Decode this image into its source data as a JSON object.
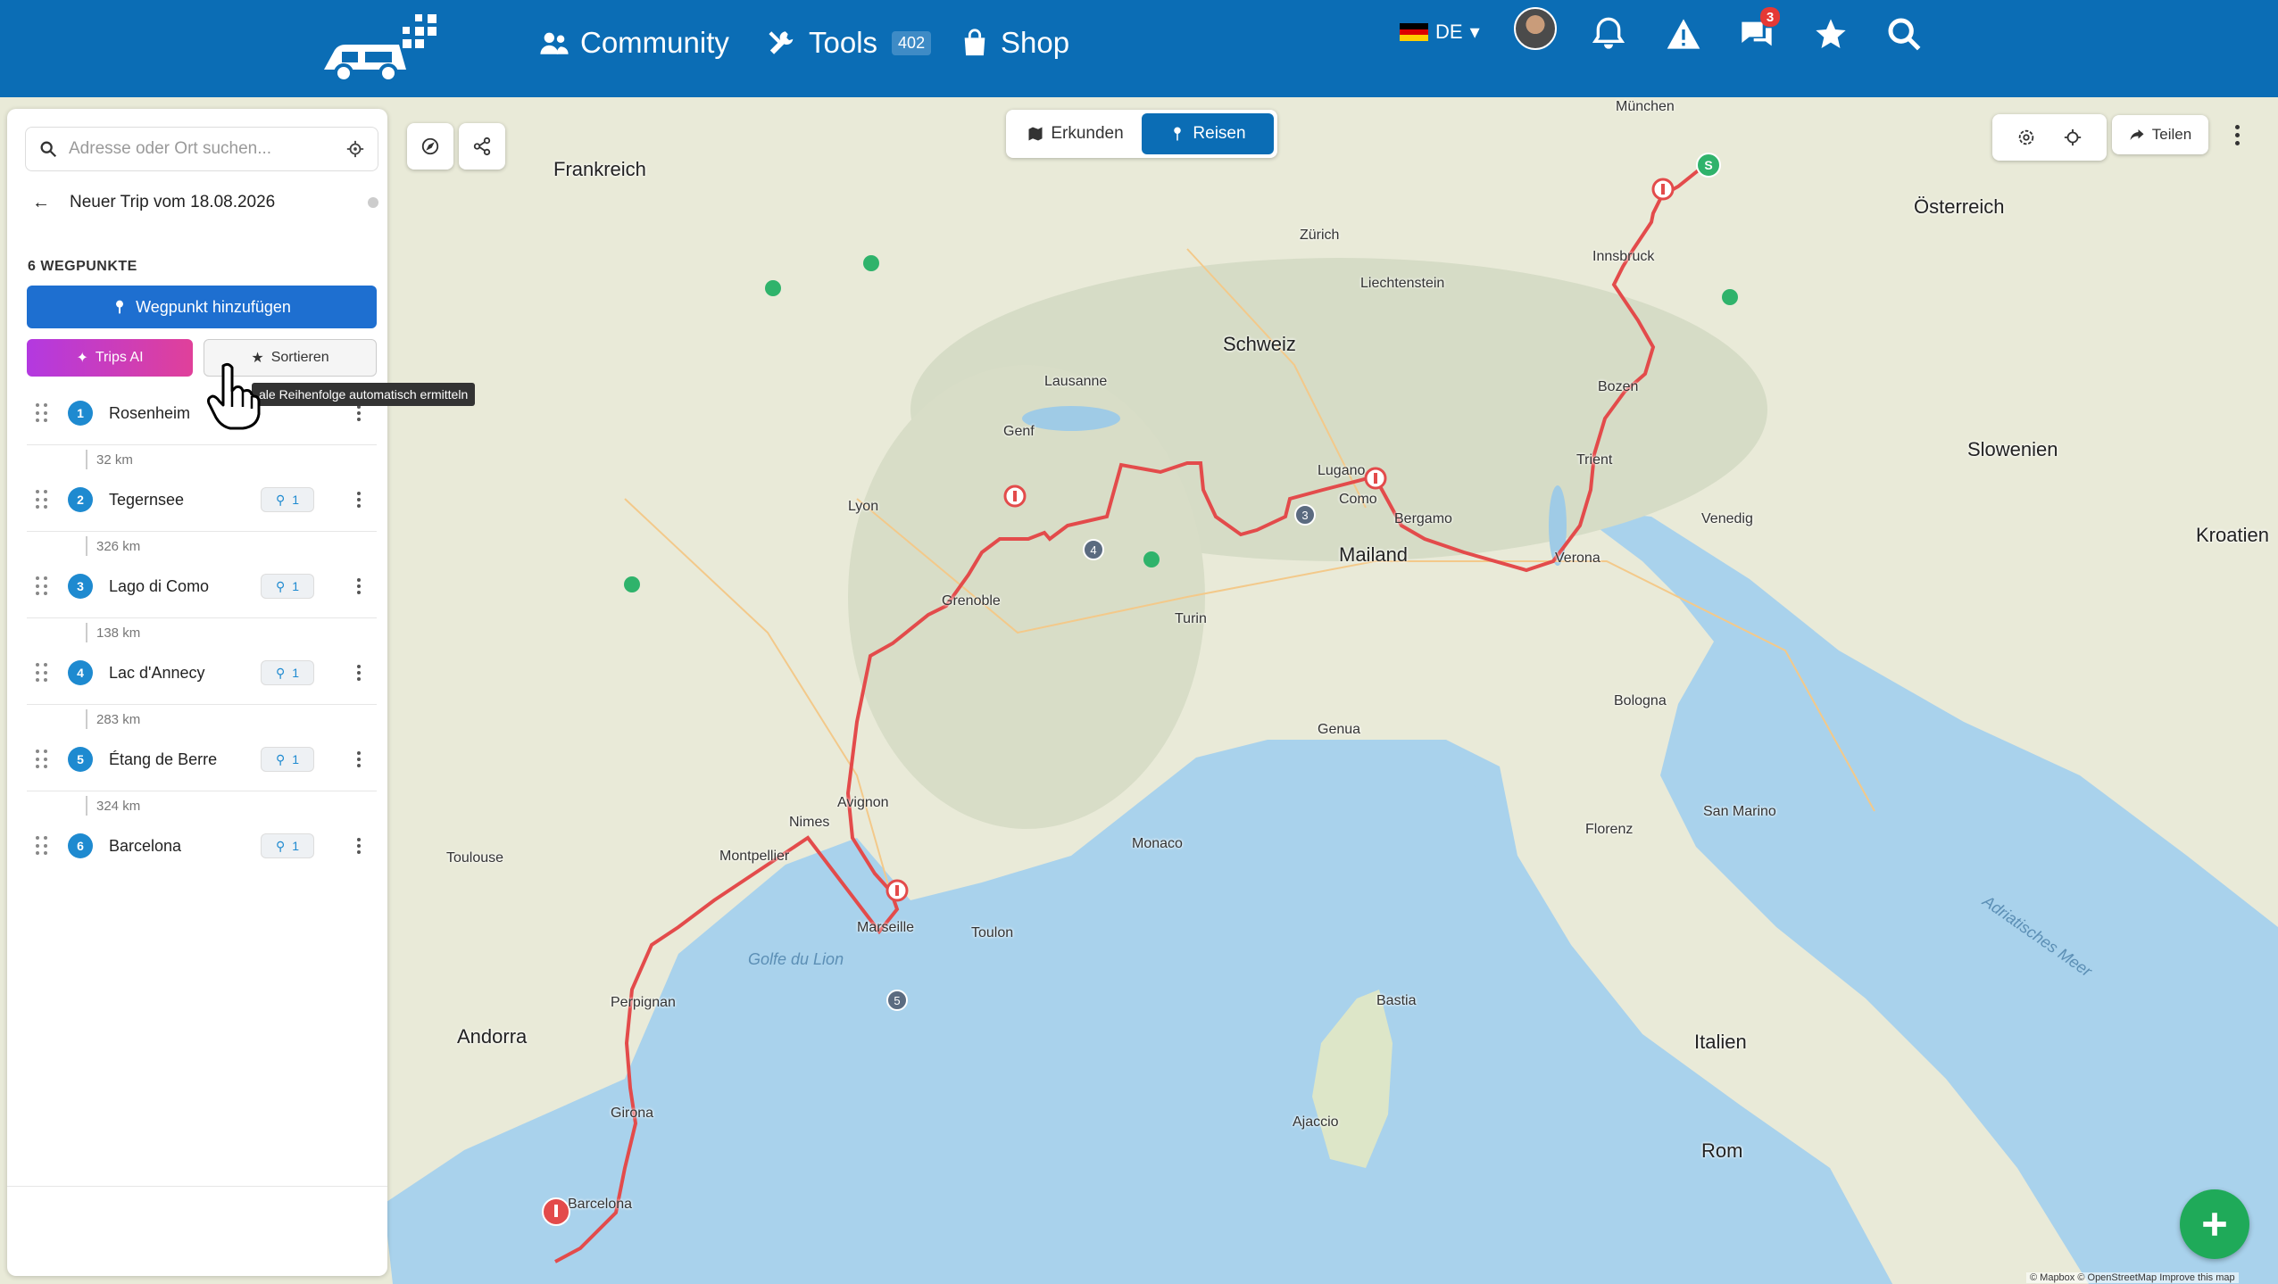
{
  "navbar": {
    "community": "Community",
    "tools": "Tools",
    "tools_badge": "402",
    "shop": "Shop",
    "language": "DE",
    "messages_badge": "3"
  },
  "sidebar": {
    "search_placeholder": "Adresse oder Ort suchen...",
    "trip_title": "Neuer Trip vom 18.08.2026",
    "waypoint_count": "6 WEGPUNKTE",
    "add_waypoint": "Wegpunkt hinzufügen",
    "trips_ai": "Trips AI",
    "sort": "Sortieren",
    "sort_tooltip": "ale Reihenfolge automatisch ermitteln",
    "waypoints": [
      {
        "num": "1",
        "name": "Rosenheim"
      },
      {
        "num": "2",
        "name": "Tegernsee",
        "pins": "1"
      },
      {
        "num": "3",
        "name": "Lago di Como",
        "pins": "1"
      },
      {
        "num": "4",
        "name": "Lac d'Annecy",
        "pins": "1"
      },
      {
        "num": "5",
        "name": "Étang de Berre",
        "pins": "1"
      },
      {
        "num": "6",
        "name": "Barcelona",
        "pins": "1"
      }
    ],
    "distances": [
      "32 km",
      "326 km",
      "138 km",
      "283 km",
      "324 km"
    ]
  },
  "map": {
    "mode_explore": "Erkunden",
    "mode_travel": "Reisen",
    "share": "Teilen",
    "attribution": "© Mapbox © OpenStreetMap  Improve this map",
    "countries": [
      "Frankreich",
      "Schweiz",
      "Liechtenstein",
      "Österreich",
      "Slowenien",
      "Kroatien",
      "Italien",
      "Andorra",
      "San Marino"
    ],
    "cities": [
      "Zürich",
      "Lausanne",
      "Genf",
      "Lyon",
      "Grenoble",
      "Turin",
      "Mailand",
      "Marseille",
      "Monaco",
      "Barcelona",
      "Rom",
      "Verona",
      "Bergamo",
      "Como",
      "Lugano",
      "Innsbruck",
      "Bozen",
      "Trient",
      "München",
      "Genua",
      "Nimes",
      "Montpellier",
      "Avignon",
      "Toulon",
      "Perpignan",
      "Girona",
      "Florenz",
      "Bologna",
      "Venedig",
      "Ajaccio",
      "Bastia",
      "Toulouse"
    ],
    "waters": [
      "Golfe du Lion",
      "Adriatisches Meer"
    ],
    "markers": [
      "3",
      "4",
      "5",
      "S"
    ]
  }
}
